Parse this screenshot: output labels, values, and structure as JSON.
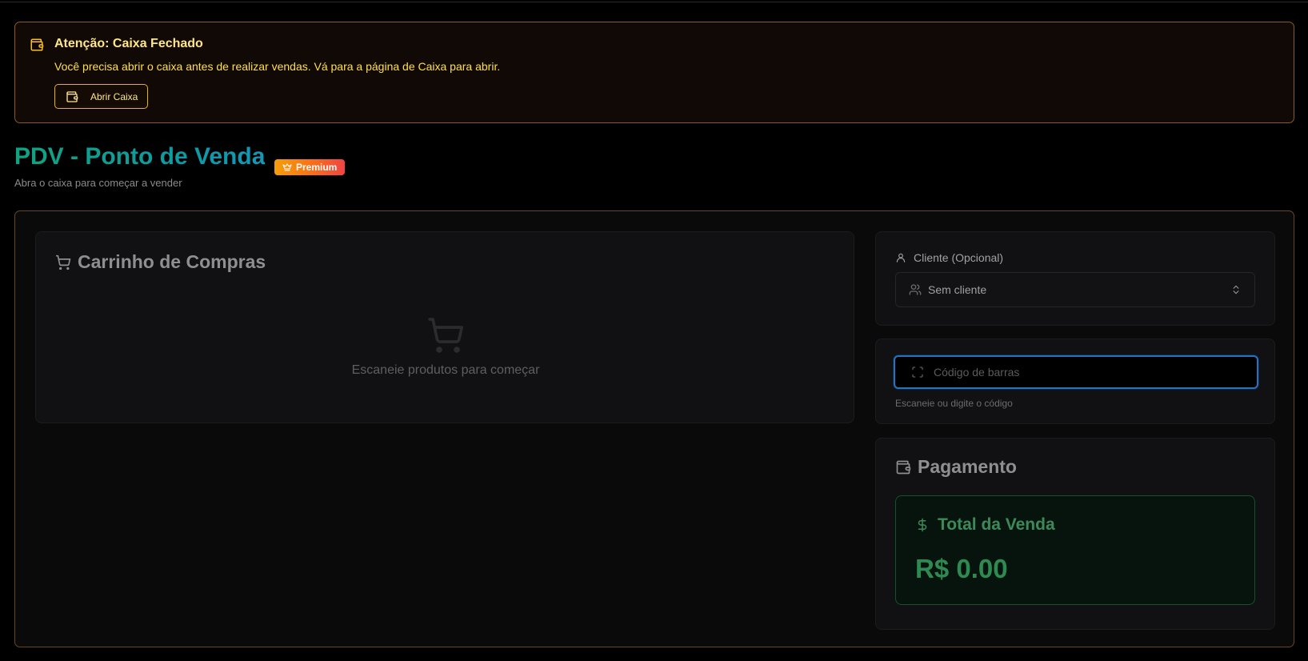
{
  "alert": {
    "title": "Atenção: Caixa Fechado",
    "message": "Você precisa abrir o caixa antes de realizar vendas. Vá para a página de Caixa para abrir.",
    "button_label": "Abrir Caixa",
    "icon": "wallet-icon"
  },
  "header": {
    "title": "PDV - Ponto de Venda",
    "badge": "Premium",
    "badge_icon": "crown-icon",
    "subtitle": "Abra o caixa para começar a vender"
  },
  "cart": {
    "title": "Carrinho de Compras",
    "empty_text": "Escaneie produtos para começar",
    "icon": "shopping-cart-icon"
  },
  "client": {
    "label": "Cliente (Opcional)",
    "selected": "Sem cliente",
    "label_icon": "user-icon",
    "select_icon": "users-icon"
  },
  "barcode": {
    "placeholder": "Código de barras",
    "value": "",
    "hint": "Escaneie ou digite o código",
    "icon": "scan-icon"
  },
  "payment": {
    "title": "Pagamento",
    "total_label": "Total da Venda",
    "total_value": "R$ 0.00",
    "icon": "wallet-icon"
  },
  "colors": {
    "alert_border": "#8a5a20",
    "alert_text": "#fde047",
    "title_gradient_start": "#10a37f",
    "title_gradient_end": "#1597b6",
    "premium_start": "#f59e0b",
    "premium_end": "#ef4444",
    "focus_ring": "#2b6fbd",
    "total_green": "#2e8a53"
  }
}
